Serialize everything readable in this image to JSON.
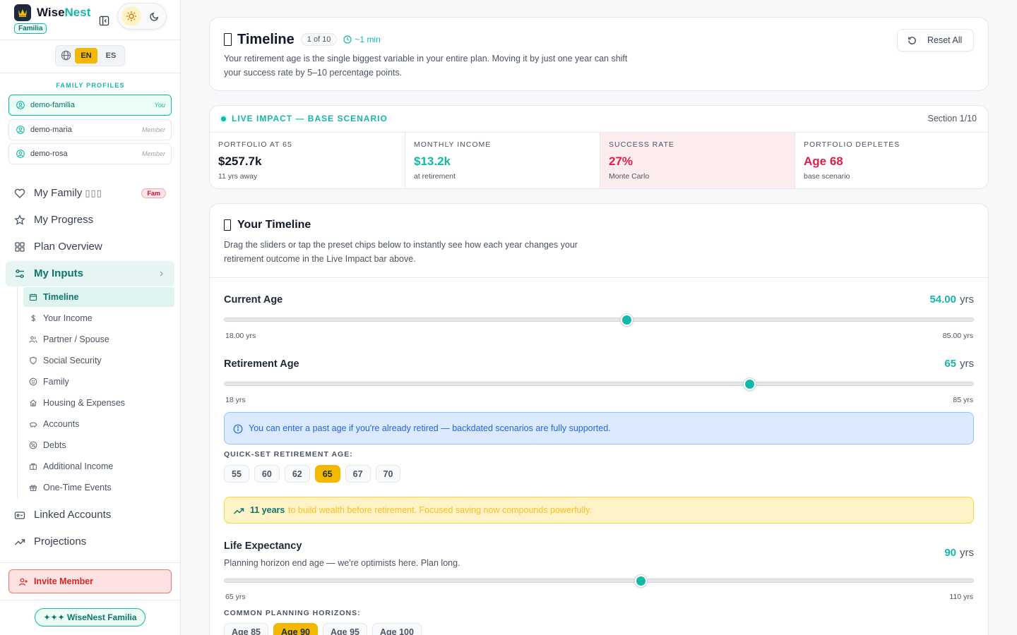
{
  "brand": {
    "name_primary": "Wise",
    "name_accent": "Nest",
    "tag": "Familia"
  },
  "language": {
    "en": "EN",
    "es": "ES",
    "selected": "EN"
  },
  "family": {
    "title": "FAMILY PROFILES",
    "profiles": [
      {
        "name": "demo-familia",
        "role": "You",
        "active": true
      },
      {
        "name": "demo-maria",
        "role": "Member",
        "active": false
      },
      {
        "name": "demo-rosa",
        "role": "Member",
        "active": false
      }
    ]
  },
  "nav": {
    "my_family": "My Family",
    "my_family_glyph": "▯▯▯",
    "my_family_badge": "Fam",
    "my_progress": "My Progress",
    "plan_overview": "Plan Overview",
    "my_inputs": "My Inputs",
    "linked_accounts": "Linked Accounts",
    "projections": "Projections",
    "sub": [
      {
        "label": "Timeline",
        "icon": "calendar-icon",
        "active": true
      },
      {
        "label": "Your Income",
        "icon": "dollar-icon"
      },
      {
        "label": "Partner / Spouse",
        "icon": "users-icon"
      },
      {
        "label": "Social Security",
        "icon": "shield-icon"
      },
      {
        "label": "Family",
        "icon": "smile-icon"
      },
      {
        "label": "Housing & Expenses",
        "icon": "home-icon"
      },
      {
        "label": "Accounts",
        "icon": "piggy-bank-icon"
      },
      {
        "label": "Debts",
        "icon": "percent-icon"
      },
      {
        "label": "Additional Income",
        "icon": "briefcase-icon"
      },
      {
        "label": "One-Time Events",
        "icon": "gift-icon"
      }
    ]
  },
  "invite": {
    "label": "Invite Member"
  },
  "plan_badge": "✦✦✦ WiseNest Familia",
  "header": {
    "title": "Timeline",
    "count": "1 of 10",
    "time": "~1 min",
    "desc": "Your retirement age is the single biggest variable in your entire plan. Moving it by just one year can shift your success rate by 5–10 percentage points.",
    "reset": "Reset All"
  },
  "impact": {
    "title": "LIVE IMPACT — BASE SCENARIO",
    "section": "Section 1/10",
    "metrics": [
      {
        "label": "PORTFOLIO AT 65",
        "value": "$257.7k",
        "sub": "11 yrs away"
      },
      {
        "label": "MONTHLY INCOME",
        "value": "$13.2k",
        "sub": "at retirement"
      },
      {
        "label": "SUCCESS RATE",
        "value": "27%",
        "sub": "Monte Carlo"
      },
      {
        "label": "PORTFOLIO DEPLETES",
        "value": "Age 68",
        "sub": "base scenario"
      }
    ]
  },
  "timeline": {
    "title": "Your Timeline",
    "desc": "Drag the sliders or tap the preset chips below to instantly see how each year changes your retirement outcome in the Live Impact bar above.",
    "current_age": {
      "label": "Current Age",
      "value": "54.00",
      "unit": "yrs",
      "min": "18.00 yrs",
      "max": "85.00 yrs",
      "min_num": 18,
      "max_num": 85,
      "num": 54
    },
    "retirement_age": {
      "label": "Retirement Age",
      "value": "65",
      "unit": "yrs",
      "min": "18 yrs",
      "max": "85 yrs",
      "min_num": 18,
      "max_num": 85,
      "num": 65
    },
    "info": "You can enter a past age if you're already retired — backdated scenarios are fully supported.",
    "quick_label": "QUICK-SET RETIREMENT AGE:",
    "quick_chips": [
      "55",
      "60",
      "62",
      "65",
      "67",
      "70"
    ],
    "quick_selected": "65",
    "warn_strong": "11 years",
    "warn_text": "to build wealth before retirement. Focused saving now compounds powerfully.",
    "life": {
      "label": "Life Expectancy",
      "hint": "Planning horizon end age — we're optimists here. Plan long.",
      "value": "90",
      "unit": "yrs",
      "min": "65 yrs",
      "max": "110 yrs",
      "min_num": 65,
      "max_num": 110,
      "num": 90
    },
    "horizon_label": "COMMON PLANNING HORIZONS:",
    "horizon_chips": [
      "Age 85",
      "Age 90",
      "Age 95",
      "Age 100"
    ],
    "horizon_selected": "Age 90"
  },
  "colors": {
    "accent": "#14b8a6",
    "gold": "#f5b800",
    "danger": "#e11d48"
  }
}
